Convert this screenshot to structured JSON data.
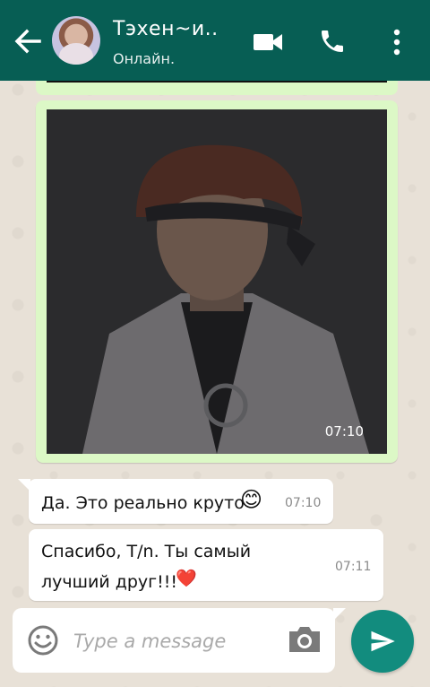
{
  "header": {
    "contact_name": "Тэхен~и..",
    "status": "Онлайн.",
    "back_icon": "arrow-left-icon",
    "video_icon": "video-camera-icon",
    "call_icon": "phone-icon",
    "menu_icon": "more-vertical-icon"
  },
  "colors": {
    "header": "#075e54",
    "outgoing_bubble": "#dcf8c6",
    "incoming_bubble": "#ffffff",
    "send_button": "#128c7e",
    "heart": "#e53935"
  },
  "messages": [
    {
      "type": "image",
      "direction": "out",
      "time": "07:10"
    },
    {
      "type": "text",
      "direction": "in",
      "text": "Да. Это реально круто",
      "emoji": "😊",
      "time": "07:10"
    },
    {
      "type": "text",
      "direction": "in",
      "lines": [
        "Спасибо, Т/n. Ты самый",
        "лучший друг!!!"
      ],
      "emoji": "❤️",
      "time": "07:11"
    }
  ],
  "composer": {
    "placeholder": "Type a message",
    "emoji_icon": "emoji-smile-icon",
    "camera_icon": "camera-icon",
    "send_icon": "send-icon"
  }
}
